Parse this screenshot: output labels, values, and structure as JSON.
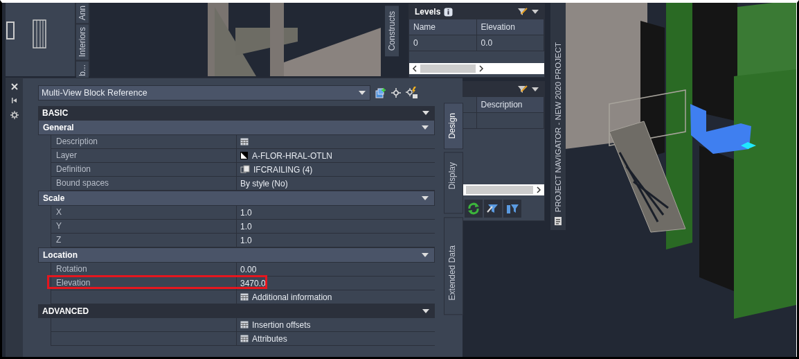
{
  "tool_palette": {
    "tabs": [
      {
        "label": "Ann",
        "selected": false
      },
      {
        "label": "Interiors",
        "selected": false
      },
      {
        "label": "b...",
        "selected": false
      }
    ]
  },
  "constructs_tab": {
    "label": "Constructs"
  },
  "levels_palette": {
    "title": "Levels",
    "columns": [
      "Name",
      "Elevation"
    ],
    "rows": [
      [
        "0",
        "0.0"
      ]
    ]
  },
  "second_palette": {
    "columns": [
      "Description"
    ]
  },
  "project_navigator": {
    "title": "PROJECT NAVIGATOR - NEW 2020 PROJECT"
  },
  "properties": {
    "object_type": "Multi-View Block Reference",
    "sections": [
      {
        "kind": "category",
        "title": "BASIC"
      },
      {
        "kind": "group",
        "title": "General",
        "rows": [
          {
            "label": "Description",
            "value": "",
            "kind": "table",
            "highlighted": false
          },
          {
            "label": "Layer",
            "value": "A-FLOR-HRAL-OTLN",
            "kind": "layer",
            "highlighted": false
          },
          {
            "label": "Definition",
            "value": "IFCRAILING (4)",
            "kind": "block",
            "highlighted": false
          },
          {
            "label": "Bound spaces",
            "value": "By style (No)",
            "kind": "text",
            "highlighted": false
          }
        ]
      },
      {
        "kind": "group",
        "title": "Scale",
        "rows": [
          {
            "label": "X",
            "value": "1.0",
            "kind": "text",
            "highlighted": false
          },
          {
            "label": "Y",
            "value": "1.0",
            "kind": "text",
            "highlighted": false
          },
          {
            "label": "Z",
            "value": "1.0",
            "kind": "text",
            "highlighted": false
          }
        ]
      },
      {
        "kind": "group",
        "title": "Location",
        "rows": [
          {
            "label": "Rotation",
            "value": "0.00",
            "kind": "text",
            "highlighted": false
          },
          {
            "label": "Elevation",
            "value": "3470.0",
            "kind": "text",
            "highlighted": true
          },
          {
            "label": "",
            "value": "Additional information",
            "kind": "table",
            "highlighted": false
          }
        ]
      },
      {
        "kind": "category",
        "title": "ADVANCED",
        "rows": [
          {
            "label": "",
            "value": "Insertion offsets",
            "kind": "table",
            "highlighted": false
          },
          {
            "label": "",
            "value": "Attributes",
            "kind": "table",
            "highlighted": false
          }
        ]
      }
    ],
    "tabs": [
      {
        "label": "Design",
        "selected": true
      },
      {
        "label": "Display",
        "selected": false
      },
      {
        "label": "Extended Data",
        "selected": false
      }
    ]
  }
}
